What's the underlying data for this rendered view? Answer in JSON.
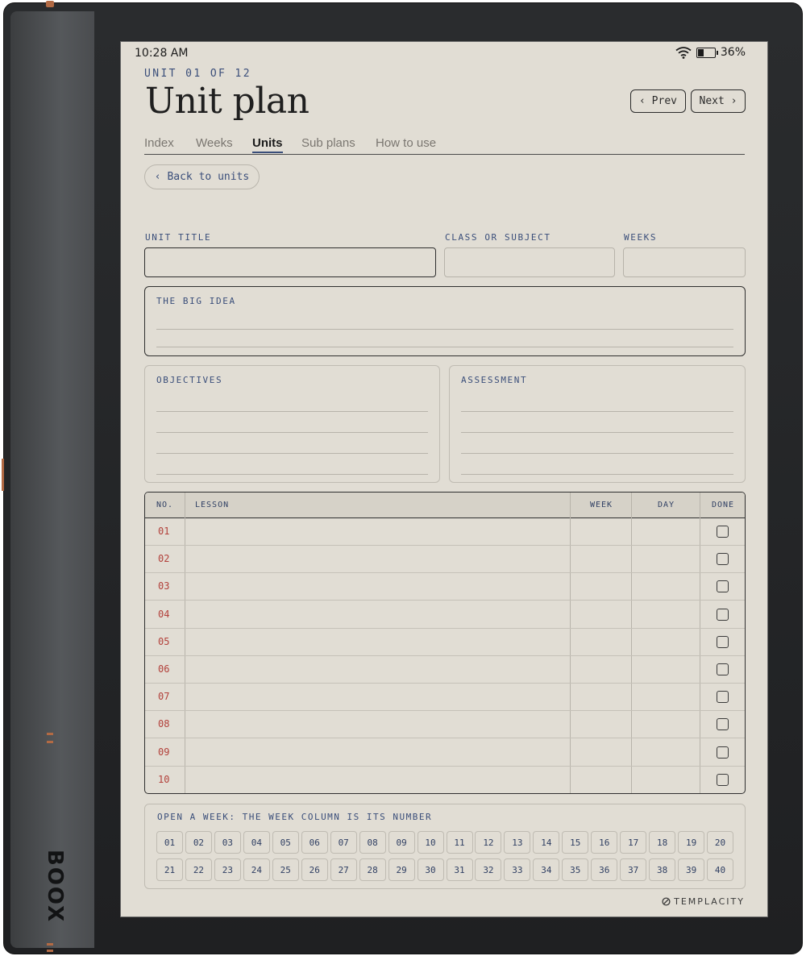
{
  "device": {
    "brand": "BOOX"
  },
  "status": {
    "time": "10:28 AM",
    "battery": "36%",
    "battery_level": 0.36
  },
  "header": {
    "eyebrow": "UNIT 01 OF 12",
    "title": "Unit plan",
    "prev_label": "‹ Prev",
    "next_label": "Next ›"
  },
  "tabs": [
    {
      "label": "Index"
    },
    {
      "label": "Weeks"
    },
    {
      "label": "Units",
      "active": true
    },
    {
      "label": "Sub plans"
    },
    {
      "label": "How to use"
    }
  ],
  "back_label": "‹ Back to units",
  "fields": {
    "unit_title": "UNIT TITLE",
    "class_subject": "CLASS OR SUBJECT",
    "weeks": "WEEKS",
    "big_idea": "THE BIG IDEA",
    "objectives": "OBJECTIVES",
    "assessment": "ASSESSMENT"
  },
  "table": {
    "headers": {
      "no": "NO.",
      "lesson": "LESSON",
      "week": "WEEK",
      "day": "DAY",
      "done": "DONE"
    },
    "rows": [
      "01",
      "02",
      "03",
      "04",
      "05",
      "06",
      "07",
      "08",
      "09",
      "10"
    ]
  },
  "week_selector": {
    "title": "OPEN A WEEK: THE WEEK COLUMN IS ITS NUMBER",
    "weeks": [
      "01",
      "02",
      "03",
      "04",
      "05",
      "06",
      "07",
      "08",
      "09",
      "10",
      "11",
      "12",
      "13",
      "14",
      "15",
      "16",
      "17",
      "18",
      "19",
      "20",
      "21",
      "22",
      "23",
      "24",
      "25",
      "26",
      "27",
      "28",
      "29",
      "30",
      "31",
      "32",
      "33",
      "34",
      "35",
      "36",
      "37",
      "38",
      "39",
      "40"
    ]
  },
  "footer": {
    "logo": "TEMPLACITY"
  },
  "colors": {
    "accent": "#3a4e7a",
    "row_number": "#b2403a",
    "paper": "#e1ddd4",
    "spine_accent": "#b26a44"
  }
}
